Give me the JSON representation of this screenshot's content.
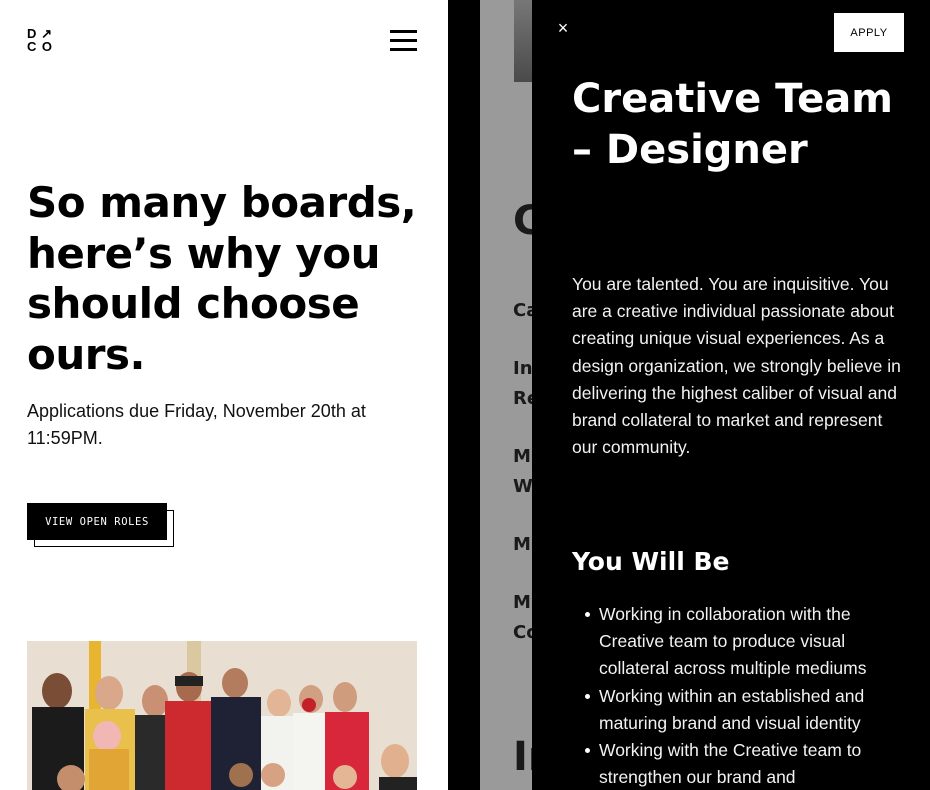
{
  "logo": {
    "row1": [
      "D",
      "↗"
    ],
    "row2": [
      "C",
      "O"
    ]
  },
  "left": {
    "hero_title": "So many boards, here’s why you should choose ours.",
    "hero_sub": "Applications due Friday, November 20th at 11:59PM.",
    "cta_label": "VIEW OPEN ROLES",
    "menu_icon": "hamburger-icon"
  },
  "middle": {
    "heading": "C",
    "items": [
      "Ca",
      "In",
      "Re",
      "M",
      "W",
      "M",
      "M",
      "Co"
    ],
    "bottom_heading": "In"
  },
  "drawer": {
    "close_label": "×",
    "apply_label": "APPLY",
    "title": "Creative Team – Designer",
    "description": "You are talented. You are inquisitive. You are a creative individual passionate about creating unique visual experiences. As a design organization, we strongly believe in delivering the highest caliber of visual and brand collateral to market and represent our community.",
    "section_heading": "You Will Be",
    "bullets": [
      "Working in collaboration with the Creative team to produce visual collateral across multiple mediums",
      "Working within an established and maturing brand and visual identity",
      "Working with the Creative team to strengthen our brand and"
    ]
  },
  "colors": {
    "drawer_bg": "#000000",
    "middle_strip": "#9a9a9a",
    "cta_bg": "#000000"
  }
}
